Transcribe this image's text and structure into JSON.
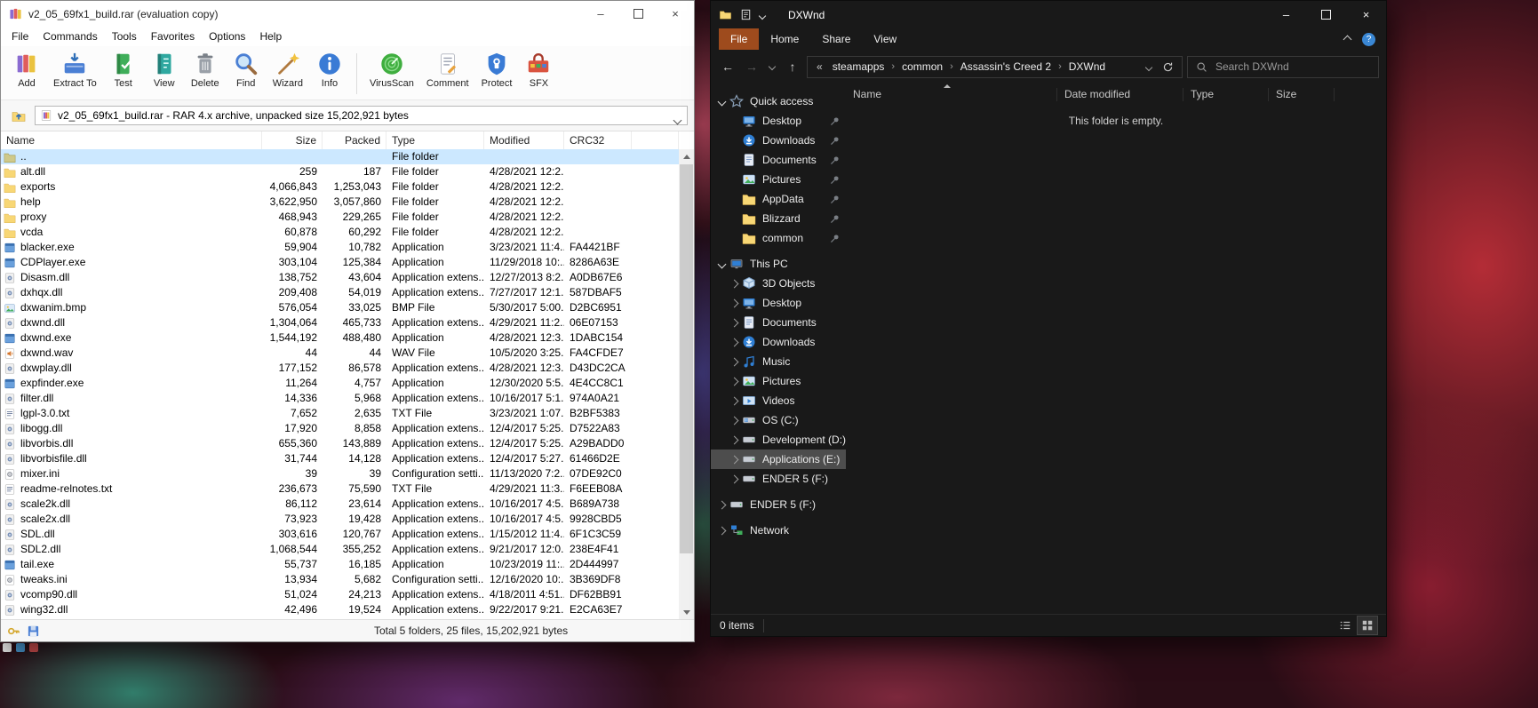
{
  "glyphs": {
    "minimize": "–",
    "close": "×",
    "back": "←",
    "forward": "→",
    "up": "↑",
    "overflow": "«",
    "crumb_separator": "›",
    "help": "?"
  },
  "colors": {
    "winrar_selected_row": "#cce8ff",
    "explorer_file_tab": "#9e4b1d",
    "explorer_selected_item": "#4d4d4d"
  },
  "winrar": {
    "title": "v2_05_69fx1_build.rar (evaluation copy)",
    "menu": [
      "File",
      "Commands",
      "Tools",
      "Favorites",
      "Options",
      "Help"
    ],
    "toolbar": [
      {
        "label": "Add",
        "icon": "add",
        "group": 1
      },
      {
        "label": "Extract To",
        "icon": "extract",
        "group": 1
      },
      {
        "label": "Test",
        "icon": "test",
        "group": 1
      },
      {
        "label": "View",
        "icon": "view",
        "group": 1
      },
      {
        "label": "Delete",
        "icon": "delete",
        "group": 1
      },
      {
        "label": "Find",
        "icon": "find",
        "group": 1
      },
      {
        "label": "Wizard",
        "icon": "wizard",
        "group": 1
      },
      {
        "label": "Info",
        "icon": "info",
        "group": 1
      },
      {
        "label": "VirusScan",
        "icon": "virusscan",
        "group": 2
      },
      {
        "label": "Comment",
        "icon": "comment",
        "group": 2
      },
      {
        "label": "Protect",
        "icon": "protect",
        "group": 2
      },
      {
        "label": "SFX",
        "icon": "sfx",
        "group": 2
      }
    ],
    "address_value": "v2_05_69fx1_build.rar - RAR 4.x archive, unpacked size 15,202,921 bytes",
    "columns": [
      {
        "label": "Name",
        "align": "left"
      },
      {
        "label": "Size",
        "align": "right"
      },
      {
        "label": "Packed",
        "align": "right"
      },
      {
        "label": "Type",
        "align": "left"
      },
      {
        "label": "Modified",
        "align": "left"
      },
      {
        "label": "CRC32",
        "align": "left"
      }
    ],
    "rows": [
      {
        "name": "..",
        "icon": "folder-up",
        "size": "",
        "packed": "",
        "type": "File folder",
        "modified": "",
        "crc": "",
        "selected": true
      },
      {
        "name": "alt.dll",
        "icon": "folder",
        "size": "259",
        "packed": "187",
        "type": "File folder",
        "modified": "4/28/2021 12:2...",
        "crc": ""
      },
      {
        "name": "exports",
        "icon": "folder",
        "size": "4,066,843",
        "packed": "1,253,043",
        "type": "File folder",
        "modified": "4/28/2021 12:2...",
        "crc": ""
      },
      {
        "name": "help",
        "icon": "folder",
        "size": "3,622,950",
        "packed": "3,057,860",
        "type": "File folder",
        "modified": "4/28/2021 12:2...",
        "crc": ""
      },
      {
        "name": "proxy",
        "icon": "folder",
        "size": "468,943",
        "packed": "229,265",
        "type": "File folder",
        "modified": "4/28/2021 12:2...",
        "crc": ""
      },
      {
        "name": "vcda",
        "icon": "folder",
        "size": "60,878",
        "packed": "60,292",
        "type": "File folder",
        "modified": "4/28/2021 12:2...",
        "crc": ""
      },
      {
        "name": "blacker.exe",
        "icon": "app",
        "size": "59,904",
        "packed": "10,782",
        "type": "Application",
        "modified": "3/23/2021 11:4...",
        "crc": "FA4421BF"
      },
      {
        "name": "CDPlayer.exe",
        "icon": "app",
        "size": "303,104",
        "packed": "125,384",
        "type": "Application",
        "modified": "11/29/2018 10:...",
        "crc": "8286A63E"
      },
      {
        "name": "Disasm.dll",
        "icon": "dll",
        "size": "138,752",
        "packed": "43,604",
        "type": "Application extens...",
        "modified": "12/27/2013 8:2...",
        "crc": "A0DB67E6"
      },
      {
        "name": "dxhqx.dll",
        "icon": "dll",
        "size": "209,408",
        "packed": "54,019",
        "type": "Application extens...",
        "modified": "7/27/2017 12:1...",
        "crc": "587DBAF5"
      },
      {
        "name": "dxwanim.bmp",
        "icon": "bmp",
        "size": "576,054",
        "packed": "33,025",
        "type": "BMP File",
        "modified": "5/30/2017 5:00...",
        "crc": "D2BC6951"
      },
      {
        "name": "dxwnd.dll",
        "icon": "dll",
        "size": "1,304,064",
        "packed": "465,733",
        "type": "Application extens...",
        "modified": "4/29/2021 11:2...",
        "crc": "06E07153"
      },
      {
        "name": "dxwnd.exe",
        "icon": "app",
        "size": "1,544,192",
        "packed": "488,480",
        "type": "Application",
        "modified": "4/28/2021 12:3...",
        "crc": "1DABC154"
      },
      {
        "name": "dxwnd.wav",
        "icon": "wav",
        "size": "44",
        "packed": "44",
        "type": "WAV File",
        "modified": "10/5/2020 3:25...",
        "crc": "FA4CFDE7"
      },
      {
        "name": "dxwplay.dll",
        "icon": "dll",
        "size": "177,152",
        "packed": "86,578",
        "type": "Application extens...",
        "modified": "4/28/2021 12:3...",
        "crc": "D43DC2CA"
      },
      {
        "name": "expfinder.exe",
        "icon": "app",
        "size": "11,264",
        "packed": "4,757",
        "type": "Application",
        "modified": "12/30/2020 5:5...",
        "crc": "4E4CC8C1"
      },
      {
        "name": "filter.dll",
        "icon": "dll",
        "size": "14,336",
        "packed": "5,968",
        "type": "Application extens...",
        "modified": "10/16/2017 5:1...",
        "crc": "974A0A21"
      },
      {
        "name": "lgpl-3.0.txt",
        "icon": "txt",
        "size": "7,652",
        "packed": "2,635",
        "type": "TXT File",
        "modified": "3/23/2021 1:07...",
        "crc": "B2BF5383"
      },
      {
        "name": "libogg.dll",
        "icon": "dll",
        "size": "17,920",
        "packed": "8,858",
        "type": "Application extens...",
        "modified": "12/4/2017 5:25...",
        "crc": "D7522A83"
      },
      {
        "name": "libvorbis.dll",
        "icon": "dll",
        "size": "655,360",
        "packed": "143,889",
        "type": "Application extens...",
        "modified": "12/4/2017 5:25...",
        "crc": "A29BADD0"
      },
      {
        "name": "libvorbisfile.dll",
        "icon": "dll",
        "size": "31,744",
        "packed": "14,128",
        "type": "Application extens...",
        "modified": "12/4/2017 5:27...",
        "crc": "61466D2E"
      },
      {
        "name": "mixer.ini",
        "icon": "ini",
        "size": "39",
        "packed": "39",
        "type": "Configuration setti...",
        "modified": "11/13/2020 7:2...",
        "crc": "07DE92C0"
      },
      {
        "name": "readme-relnotes.txt",
        "icon": "txt",
        "size": "236,673",
        "packed": "75,590",
        "type": "TXT File",
        "modified": "4/29/2021 11:3...",
        "crc": "F6EEB08A"
      },
      {
        "name": "scale2k.dll",
        "icon": "dll",
        "size": "86,112",
        "packed": "23,614",
        "type": "Application extens...",
        "modified": "10/16/2017 4:5...",
        "crc": "B689A738"
      },
      {
        "name": "scale2x.dll",
        "icon": "dll",
        "size": "73,923",
        "packed": "19,428",
        "type": "Application extens...",
        "modified": "10/16/2017 4:5...",
        "crc": "9928CBD5"
      },
      {
        "name": "SDL.dll",
        "icon": "dll",
        "size": "303,616",
        "packed": "120,767",
        "type": "Application extens...",
        "modified": "1/15/2012 11:4...",
        "crc": "6F1C3C59"
      },
      {
        "name": "SDL2.dll",
        "icon": "dll",
        "size": "1,068,544",
        "packed": "355,252",
        "type": "Application extens...",
        "modified": "9/21/2017 12:0...",
        "crc": "238E4F41"
      },
      {
        "name": "tail.exe",
        "icon": "app",
        "size": "55,737",
        "packed": "16,185",
        "type": "Application",
        "modified": "10/23/2019 11:...",
        "crc": "2D444997"
      },
      {
        "name": "tweaks.ini",
        "icon": "ini",
        "size": "13,934",
        "packed": "5,682",
        "type": "Configuration setti...",
        "modified": "12/16/2020 10:...",
        "crc": "3B369DF8"
      },
      {
        "name": "vcomp90.dll",
        "icon": "dll",
        "size": "51,024",
        "packed": "24,213",
        "type": "Application extens...",
        "modified": "4/18/2011 4:51...",
        "crc": "DF62BB91"
      },
      {
        "name": "wing32.dll",
        "icon": "dll",
        "size": "42,496",
        "packed": "19,524",
        "type": "Application extens...",
        "modified": "9/22/2017 9:21...",
        "crc": "E2CA63E7"
      }
    ],
    "status_total": "Total 5 folders, 25 files, 15,202,921 bytes"
  },
  "explorer": {
    "title": "DXWnd",
    "ribbon_tabs": [
      "File",
      "Home",
      "Share",
      "View"
    ],
    "breadcrumbs": [
      "steamapps",
      "common",
      "Assassin's Creed 2",
      "DXWnd"
    ],
    "search_placeholder": "Search DXWnd",
    "columns": [
      "Name",
      "Date modified",
      "Type",
      "Size"
    ],
    "empty_text": "This folder is empty.",
    "status_items": "0 items",
    "sidebar": [
      {
        "label": "Quick access",
        "icon": "star",
        "chevron": "down",
        "level": 0
      },
      {
        "label": "Desktop",
        "icon": "desktop",
        "pin": true,
        "level": 1
      },
      {
        "label": "Downloads",
        "icon": "downloads",
        "pin": true,
        "level": 1
      },
      {
        "label": "Documents",
        "icon": "documents",
        "pin": true,
        "level": 1
      },
      {
        "label": "Pictures",
        "icon": "pictures",
        "pin": true,
        "level": 1
      },
      {
        "label": "AppData",
        "icon": "folder",
        "pin": true,
        "level": 1
      },
      {
        "label": "Blizzard",
        "icon": "folder",
        "pin": true,
        "level": 1
      },
      {
        "label": "common",
        "icon": "folder",
        "pin": true,
        "level": 1
      },
      {
        "label": "This PC",
        "icon": "pc",
        "chevron": "down",
        "level": 0,
        "gap": true
      },
      {
        "label": "3D Objects",
        "icon": "obj3d",
        "chevron": "right",
        "level": 1
      },
      {
        "label": "Desktop",
        "icon": "desktop",
        "chevron": "right",
        "level": 1
      },
      {
        "label": "Documents",
        "icon": "documents",
        "chevron": "right",
        "level": 1
      },
      {
        "label": "Downloads",
        "icon": "downloads",
        "chevron": "right",
        "level": 1
      },
      {
        "label": "Music",
        "icon": "music",
        "chevron": "right",
        "level": 1
      },
      {
        "label": "Pictures",
        "icon": "pictures",
        "chevron": "right",
        "level": 1
      },
      {
        "label": "Videos",
        "icon": "videos",
        "chevron": "right",
        "level": 1
      },
      {
        "label": "OS (C:)",
        "icon": "drive-os",
        "chevron": "right",
        "level": 1
      },
      {
        "label": "Development (D:)",
        "icon": "drive",
        "chevron": "right",
        "level": 1
      },
      {
        "label": "Applications (E:)",
        "icon": "drive",
        "chevron": "right",
        "level": 1,
        "selected": true
      },
      {
        "label": "ENDER 5 (F:)",
        "icon": "drive",
        "chevron": "right",
        "level": 1
      },
      {
        "label": "ENDER 5 (F:)",
        "icon": "drive",
        "chevron": "right",
        "level": 0,
        "gap": true
      },
      {
        "label": "Network",
        "icon": "network",
        "chevron": "right",
        "level": 0,
        "gap": true
      }
    ]
  }
}
